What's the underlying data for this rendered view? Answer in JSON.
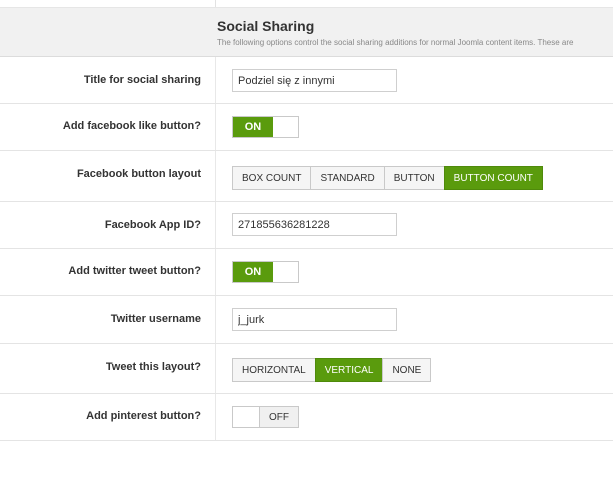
{
  "section": {
    "title": "Social Sharing",
    "description": "The following options control the social sharing additions for normal Joomla content items. These are"
  },
  "fields": {
    "title_label": "Title for social sharing",
    "title_value": "Podziel się z innymi",
    "fb_like_label": "Add facebook like button?",
    "fb_like_state": "ON",
    "fb_layout_label": "Facebook button layout",
    "fb_layout_options": [
      "BOX COUNT",
      "STANDARD",
      "BUTTON",
      "BUTTON COUNT"
    ],
    "fb_layout_selected": "BUTTON COUNT",
    "fb_appid_label": "Facebook App ID?",
    "fb_appid_value": "271855636281228",
    "tw_tweet_label": "Add twitter tweet button?",
    "tw_tweet_state": "ON",
    "tw_user_label": "Twitter username",
    "tw_user_value": "j_jurk",
    "tw_layout_label": "Tweet this layout?",
    "tw_layout_options": [
      "HORIZONTAL",
      "VERTICAL",
      "NONE"
    ],
    "tw_layout_selected": "VERTICAL",
    "pin_label": "Add pinterest button?",
    "pin_state": "OFF"
  },
  "colors": {
    "accent_green": "#5a9b0d",
    "header_bg": "#f1f1f1"
  }
}
